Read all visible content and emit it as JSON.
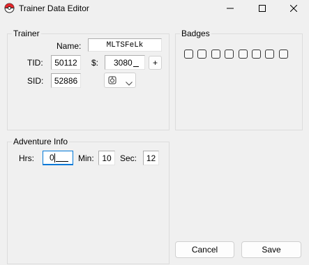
{
  "window": {
    "title": "Trainer Data Editor",
    "icon": "pokeball-icon",
    "controls": [
      "minimize-icon",
      "maximize-icon",
      "close-icon"
    ]
  },
  "trainer": {
    "group_label": "Trainer",
    "name_label": "Name:",
    "name_value": "MLTSFeLk",
    "tid_label": "TID:",
    "tid_value": "50112",
    "money_label": "$:",
    "money_value": "3080",
    "plus_label": "+",
    "sid_label": "SID:",
    "sid_value": "52886",
    "gender_icon": "gender-glyph-icon"
  },
  "badges": {
    "group_label": "Badges",
    "count": 8,
    "checked": [
      false,
      false,
      false,
      false,
      false,
      false,
      false,
      false
    ]
  },
  "adventure": {
    "group_label": "Adventure Info",
    "hrs_label": "Hrs:",
    "hrs_value": "0",
    "min_label": "Min:",
    "min_value": "10",
    "sec_label": "Sec:",
    "sec_value": "12"
  },
  "footer": {
    "cancel_label": "Cancel",
    "save_label": "Save"
  },
  "colors": {
    "accent": "#0078d7",
    "background": "#f0f0f0"
  }
}
